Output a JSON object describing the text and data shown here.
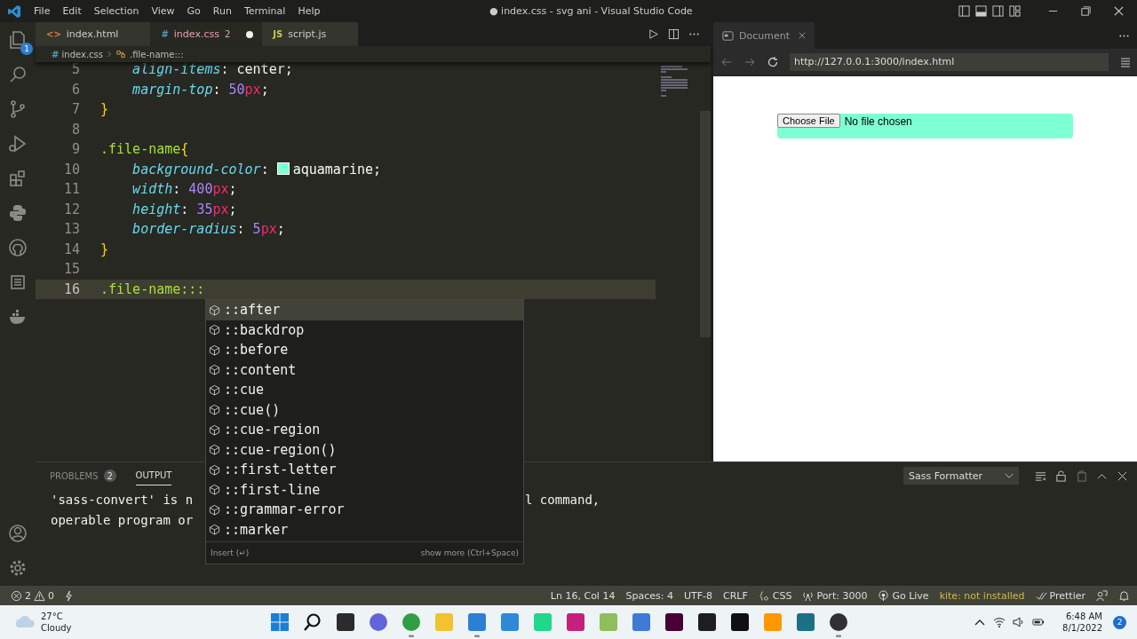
{
  "title_bar": {
    "menu": [
      "File",
      "Edit",
      "Selection",
      "View",
      "Go",
      "Run",
      "Terminal",
      "Help"
    ],
    "title": "● index.css - svg ani - Visual Studio Code"
  },
  "activity_bar": {
    "items": [
      {
        "kind": "explorer",
        "badge": "1"
      },
      {
        "kind": "search"
      },
      {
        "kind": "source-control"
      },
      {
        "kind": "run"
      },
      {
        "kind": "extensions"
      },
      {
        "kind": "python"
      },
      {
        "kind": "github"
      },
      {
        "kind": "panel"
      },
      {
        "kind": "docker"
      }
    ],
    "bottom": [
      {
        "kind": "account"
      },
      {
        "kind": "settings"
      }
    ]
  },
  "editor": {
    "tabs": [
      {
        "kind": "html",
        "icon": "<>",
        "label": "index.html",
        "selected": false,
        "modified": false
      },
      {
        "kind": "css",
        "icon": "#",
        "label": "index.css",
        "badge": "2",
        "selected": true,
        "modified": true
      },
      {
        "kind": "js",
        "icon": "JS",
        "label": "script.js",
        "selected": false,
        "modified": false
      }
    ],
    "breadcrumbs": {
      "file_icon": "#",
      "file": "index.css",
      "symbol": ".file-name:::"
    },
    "lines": [
      {
        "number": "5",
        "current": false,
        "tokens": [
          {
            "kind": "prop",
            "text": "    align-items"
          },
          {
            "kind": "punct",
            "text": ": "
          },
          {
            "kind": "val",
            "text": "center"
          },
          {
            "kind": "punct",
            "text": ";"
          }
        ]
      },
      {
        "number": "6",
        "current": false,
        "tokens": [
          {
            "kind": "prop",
            "text": "    margin-top"
          },
          {
            "kind": "punct",
            "text": ": "
          },
          {
            "kind": "num",
            "text": "50"
          },
          {
            "kind": "unit",
            "text": "px"
          },
          {
            "kind": "punct",
            "text": ";"
          }
        ]
      },
      {
        "number": "7",
        "current": false,
        "tokens": [
          {
            "kind": "brace",
            "text": "}"
          }
        ]
      },
      {
        "number": "8",
        "current": false
      },
      {
        "number": "9",
        "current": false,
        "tokens": [
          {
            "kind": "sel",
            "text": ".file-name"
          },
          {
            "kind": "brace",
            "text": "{"
          }
        ]
      },
      {
        "number": "10",
        "current": false,
        "tokens": [
          {
            "kind": "prop",
            "text": "    background-color"
          },
          {
            "kind": "punct",
            "text": ": "
          },
          {
            "kind": "swatch",
            "color": "#7fffd4"
          },
          {
            "kind": "val",
            "text": "aquamarine"
          },
          {
            "kind": "punct",
            "text": ";"
          }
        ]
      },
      {
        "number": "11",
        "current": false,
        "tokens": [
          {
            "kind": "prop",
            "text": "    width"
          },
          {
            "kind": "punct",
            "text": ": "
          },
          {
            "kind": "num",
            "text": "400"
          },
          {
            "kind": "unit",
            "text": "px"
          },
          {
            "kind": "punct",
            "text": ";"
          }
        ]
      },
      {
        "number": "12",
        "current": false,
        "tokens": [
          {
            "kind": "prop",
            "text": "    height"
          },
          {
            "kind": "punct",
            "text": ": "
          },
          {
            "kind": "num",
            "text": "35"
          },
          {
            "kind": "unit",
            "text": "px"
          },
          {
            "kind": "punct",
            "text": ";"
          }
        ]
      },
      {
        "number": "13",
        "current": false,
        "tokens": [
          {
            "kind": "prop",
            "text": "    border-radius"
          },
          {
            "kind": "punct",
            "text": ": "
          },
          {
            "kind": "num",
            "text": "5"
          },
          {
            "kind": "unit",
            "text": "px"
          },
          {
            "kind": "punct",
            "text": ";"
          }
        ]
      },
      {
        "number": "14",
        "current": false,
        "tokens": [
          {
            "kind": "brace",
            "text": "}"
          }
        ]
      },
      {
        "number": "15",
        "current": false
      },
      {
        "number": "16",
        "current": true,
        "tokens": [
          {
            "kind": "sel",
            "text": ".file-name:::"
          }
        ]
      }
    ]
  },
  "suggestions": {
    "items": [
      {
        "label": "::after",
        "selected": true
      },
      {
        "label": "::backdrop",
        "selected": false
      },
      {
        "label": "::before",
        "selected": false
      },
      {
        "label": "::content",
        "selected": false
      },
      {
        "label": "::cue",
        "selected": false
      },
      {
        "label": "::cue()",
        "selected": false
      },
      {
        "label": "::cue-region",
        "selected": false
      },
      {
        "label": "::cue-region()",
        "selected": false
      },
      {
        "label": "::first-letter",
        "selected": false
      },
      {
        "label": "::first-line",
        "selected": false
      },
      {
        "label": "::grammar-error",
        "selected": false
      },
      {
        "label": "::marker",
        "selected": false
      }
    ],
    "insert_hint": "Insert (↵)",
    "more_hint": "show more (Ctrl+Space)"
  },
  "browser": {
    "tab": "Document",
    "url": "http://127.0.0.1:3000/index.html",
    "page": {
      "button": "Choose File",
      "status": "No file chosen"
    }
  },
  "panel": {
    "tabs": [
      {
        "label": "PROBLEMS",
        "badge": "2",
        "selected": false
      },
      {
        "label": "OUTPUT",
        "selected": true
      }
    ],
    "channel": "Sass Formatter",
    "output": [
      {
        "left": "'sass-convert' is n",
        "right": "l command,"
      },
      {
        "left": "operable program or"
      }
    ]
  },
  "status_bar": {
    "errors": "2",
    "warnings": "0",
    "items": [
      {
        "kind": "text",
        "label": "Ln 16, Col 14"
      },
      {
        "kind": "text",
        "label": "Spaces: 4"
      },
      {
        "kind": "text",
        "label": "UTF-8"
      },
      {
        "kind": "text",
        "label": "CRLF"
      },
      {
        "kind": "language",
        "label": "CSS"
      },
      {
        "kind": "port",
        "label": "Port: 3000"
      },
      {
        "kind": "live",
        "label": "Go Live"
      },
      {
        "kind": "warning",
        "label": "kite: not installed"
      },
      {
        "kind": "prettier",
        "label": "Prettier"
      }
    ]
  },
  "taskbar": {
    "weather": {
      "temp": "27°C",
      "condition": "Cloudy"
    },
    "apps": [
      {
        "kind": "start",
        "running": false
      },
      {
        "kind": "search",
        "running": false
      },
      {
        "kind": "tile",
        "color": "#2b2b2b",
        "running": false
      },
      {
        "kind": "round",
        "color": "#6264d9",
        "running": false
      },
      {
        "kind": "round",
        "color": "#2f9e44",
        "running": true
      },
      {
        "kind": "tile",
        "color": "#f2c230",
        "running": false
      },
      {
        "kind": "tile",
        "color": "#2d7fd3",
        "running": true
      },
      {
        "kind": "tile",
        "color": "#2e89d8",
        "running": false
      },
      {
        "kind": "tile",
        "color": "#21d789",
        "running": false
      },
      {
        "kind": "tile",
        "color": "#c3217e",
        "running": false
      },
      {
        "kind": "tile",
        "color": "#8fbf5a",
        "running": false
      },
      {
        "kind": "tile",
        "color": "#3f7ad6",
        "running": false
      },
      {
        "kind": "tile",
        "color": "#470137",
        "running": false
      },
      {
        "kind": "tile",
        "color": "#1e1e1e",
        "running": false
      },
      {
        "kind": "tile",
        "color": "#101010",
        "running": false
      },
      {
        "kind": "tile",
        "color": "#ff9800",
        "running": false
      },
      {
        "kind": "tile",
        "color": "#1c6f84",
        "running": false
      },
      {
        "kind": "round",
        "color": "#303030",
        "running": true
      }
    ],
    "time": "6:48 AM",
    "date": "8/1/2022",
    "notifications": "2"
  }
}
